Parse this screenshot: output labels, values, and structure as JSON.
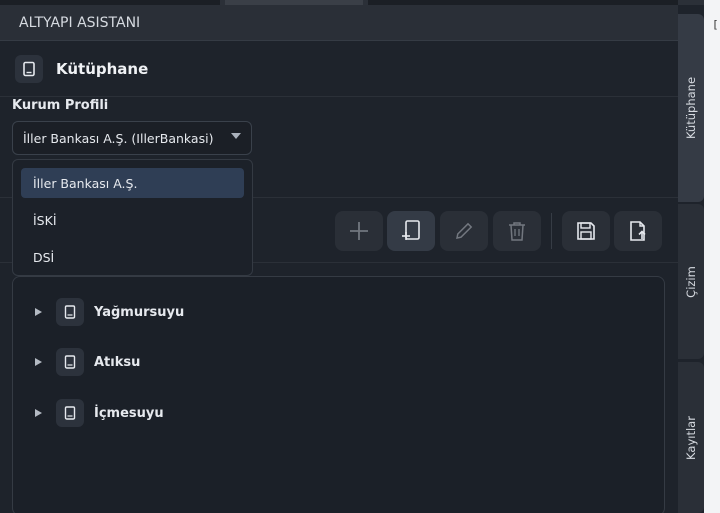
{
  "app": {
    "title": "ALTYAPI ASISTANI"
  },
  "section": {
    "title": "Kütüphane",
    "icon": "book-icon"
  },
  "profile": {
    "label": "Kurum Profili",
    "selected": "İller Bankası A.Ş. (IllerBankasi)",
    "options": [
      "İller Bankası A.Ş.",
      "İSKİ",
      "DSİ"
    ]
  },
  "toolbar": {
    "buttons": [
      "add-icon",
      "add-document-icon",
      "edit-icon",
      "delete-icon",
      "save-icon",
      "export-icon"
    ]
  },
  "tree": {
    "nodes": [
      {
        "label": "Yağmursuyu",
        "icon": "book-icon"
      },
      {
        "label": "Atıksu",
        "icon": "book-icon"
      },
      {
        "label": "İçmesuyu",
        "icon": "book-icon"
      }
    ]
  },
  "sidetabs": [
    "Kütüphane",
    "Çizim",
    "Kayıtlar"
  ],
  "edge": {
    "text": "["
  }
}
